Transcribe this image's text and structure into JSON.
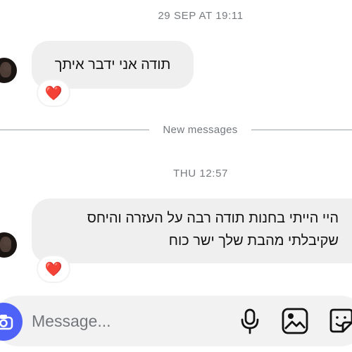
{
  "conversation": {
    "timestamps": [
      "29 SEP AT 19:11",
      "THU 12:57"
    ],
    "messages": [
      {
        "text": "תודה אני ידבר איתך",
        "reaction": "❤️"
      },
      {
        "text": "היי הייתי בחנות תודה רבה על העזרה והיחס שקיבלתי מהבת שלך ישר כוח",
        "reaction": "❤️"
      }
    ],
    "new_messages_label": "New messages"
  },
  "composer": {
    "placeholder": "Message...",
    "icons": [
      "camera-icon",
      "microphone-icon",
      "gallery-icon",
      "sticker-icon"
    ]
  },
  "colors": {
    "accent": "#4f62f7",
    "bubble": "#efefef",
    "heart": "#e0213a",
    "muted_text": "#777b80"
  }
}
